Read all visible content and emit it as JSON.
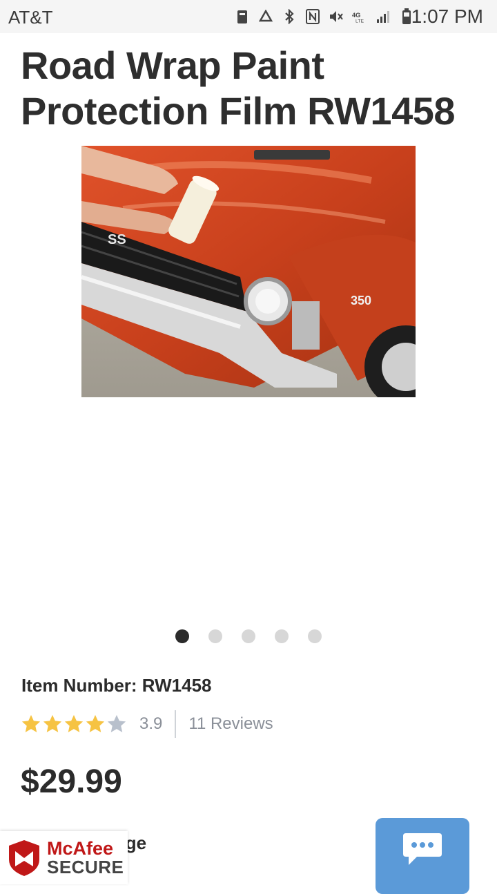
{
  "status_bar": {
    "carrier": "AT&T",
    "time": "1:07 PM",
    "icons": [
      "storage-icon",
      "recycle-icon",
      "bluetooth-icon",
      "nfc-icon",
      "mute-icon",
      "4g-lte-icon",
      "signal-icon",
      "battery-icon"
    ]
  },
  "product": {
    "title": "Road Wrap Paint Protection Film RW1458",
    "item_number": "Item Number: RW1458",
    "rating": {
      "value": "3.9",
      "reviews": "11 Reviews",
      "stars_filled": 4,
      "stars_total": 5
    },
    "price": "$29.99",
    "partial_text": "udge"
  },
  "hero_image": {
    "car_badges": {
      "grille_badge": "SS",
      "fender_badge": "350"
    }
  },
  "carousel": {
    "total": 5,
    "active_index": 0
  },
  "mcafee": {
    "brand": "McAfee",
    "secure": "SECURE"
  },
  "colors": {
    "star_filled": "#f6c343",
    "star_empty": "#b8c0cc",
    "chat_bg": "#5b9ad8",
    "mcafee_red": "#c01818"
  }
}
